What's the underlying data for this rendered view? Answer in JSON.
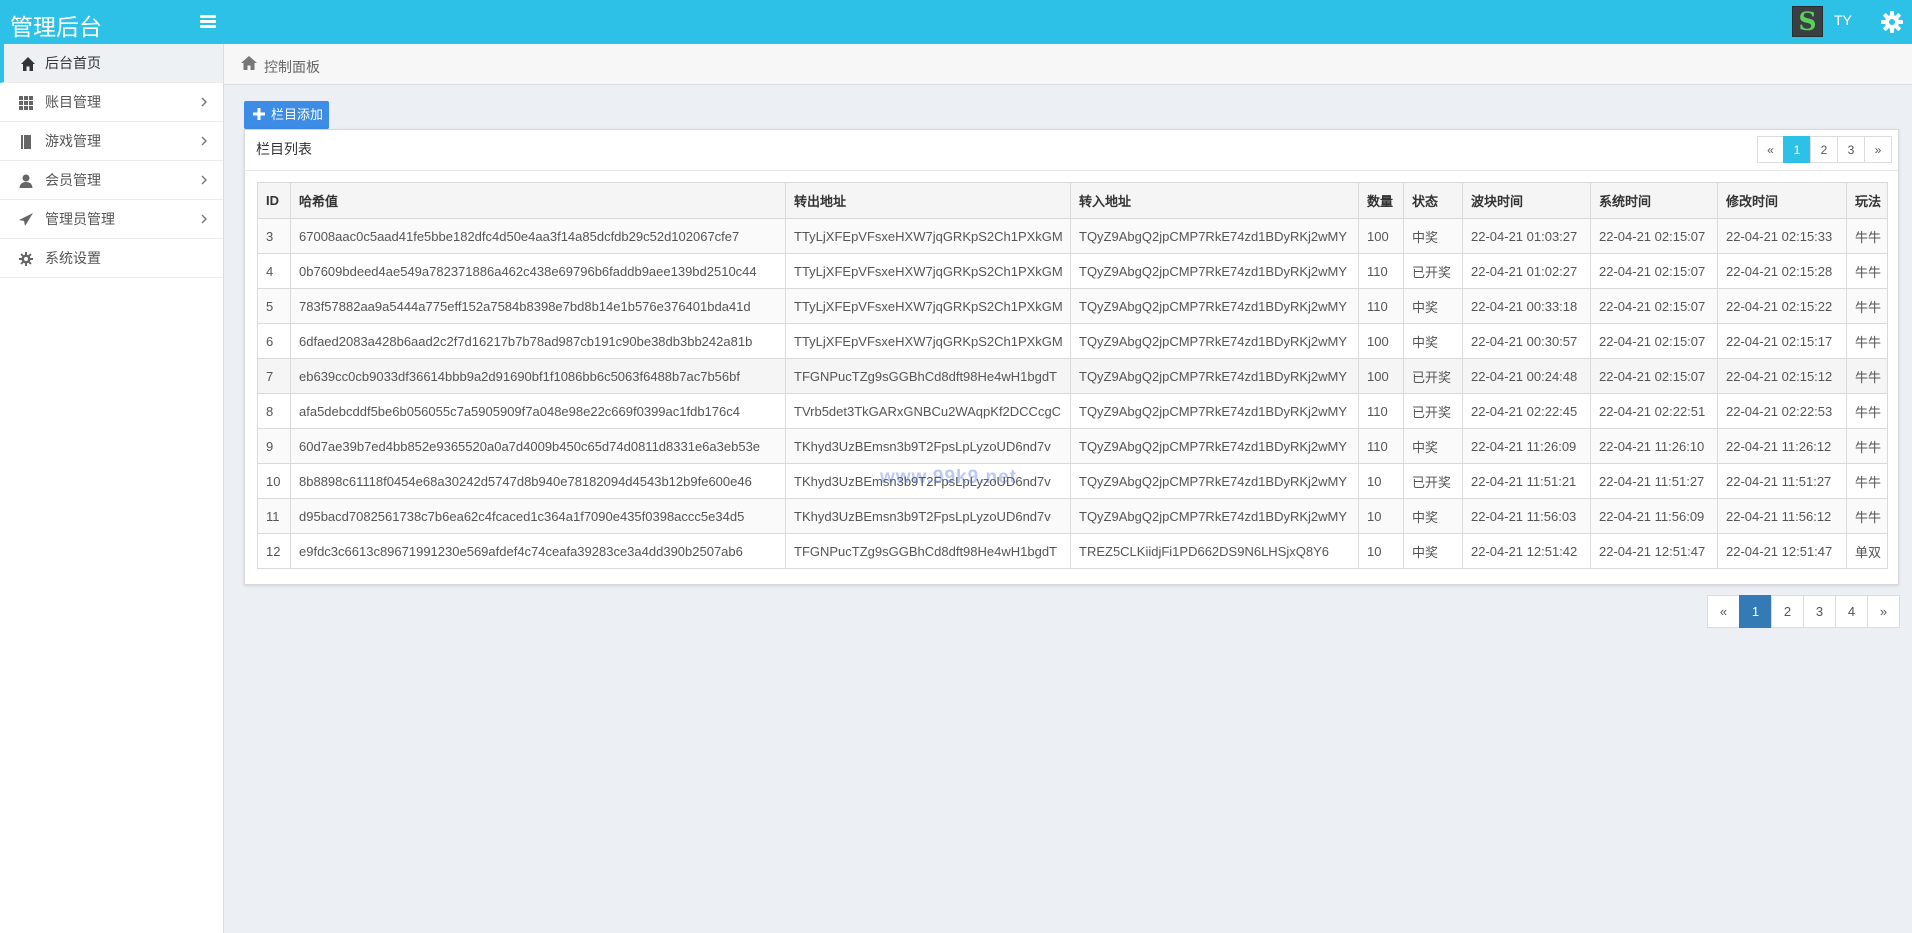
{
  "app": {
    "title": "管理后台"
  },
  "header": {
    "avatar_letter": "S",
    "username": "TY"
  },
  "sidebar": {
    "items": [
      {
        "label": "后台首页",
        "icon": "home-icon"
      },
      {
        "label": "账目管理",
        "icon": "grid-icon"
      },
      {
        "label": "游戏管理",
        "icon": "book-icon"
      },
      {
        "label": "会员管理",
        "icon": "user-icon"
      },
      {
        "label": "管理员管理",
        "icon": "send-icon"
      },
      {
        "label": "系统设置",
        "icon": "gear-icon"
      }
    ]
  },
  "breadcrumb": {
    "label": "控制面板"
  },
  "toolbar": {
    "add_label": "栏目添加"
  },
  "panel": {
    "title": "栏目列表"
  },
  "pagination_top": [
    "«",
    "1",
    "2",
    "3",
    "»"
  ],
  "pagination_bottom": [
    "«",
    "1",
    "2",
    "3",
    "4",
    "»"
  ],
  "table": {
    "headers": [
      "ID",
      "哈希值",
      "转出地址",
      "转入地址",
      "数量",
      "状态",
      "波块时间",
      "系统时间",
      "修改时间",
      "玩法"
    ],
    "rows": [
      [
        "3",
        "67008aac0c5aad41fe5bbe182dfc4d50e4aa3f14a85dcfdb29c52d102067cfe7",
        "TTyLjXFEpVFsxeHXW7jqGRKpS2Ch1PXkGM",
        "TQyZ9AbgQ2jpCMP7RkE74zd1BDyRKj2wMY",
        "100",
        "中奖",
        "22-04-21 01:03:27",
        "22-04-21 02:15:07",
        "22-04-21 02:15:33",
        "牛牛"
      ],
      [
        "4",
        "0b7609bdeed4ae549a782371886a462c438e69796b6faddb9aee139bd2510c44",
        "TTyLjXFEpVFsxeHXW7jqGRKpS2Ch1PXkGM",
        "TQyZ9AbgQ2jpCMP7RkE74zd1BDyRKj2wMY",
        "110",
        "已开奖",
        "22-04-21 01:02:27",
        "22-04-21 02:15:07",
        "22-04-21 02:15:28",
        "牛牛"
      ],
      [
        "5",
        "783f57882aa9a5444a775eff152a7584b8398e7bd8b14e1b576e376401bda41d",
        "TTyLjXFEpVFsxeHXW7jqGRKpS2Ch1PXkGM",
        "TQyZ9AbgQ2jpCMP7RkE74zd1BDyRKj2wMY",
        "110",
        "中奖",
        "22-04-21 00:33:18",
        "22-04-21 02:15:07",
        "22-04-21 02:15:22",
        "牛牛"
      ],
      [
        "6",
        "6dfaed2083a428b6aad2c2f7d16217b7b78ad987cb191c90be38db3bb242a81b",
        "TTyLjXFEpVFsxeHXW7jqGRKpS2Ch1PXkGM",
        "TQyZ9AbgQ2jpCMP7RkE74zd1BDyRKj2wMY",
        "100",
        "中奖",
        "22-04-21 00:30:57",
        "22-04-21 02:15:07",
        "22-04-21 02:15:17",
        "牛牛"
      ],
      [
        "7",
        "eb639cc0cb9033df36614bbb9a2d91690bf1f1086bb6c5063f6488b7ac7b56bf",
        "TFGNPucTZg9sGGBhCd8dft98He4wH1bgdT",
        "TQyZ9AbgQ2jpCMP7RkE74zd1BDyRKj2wMY",
        "100",
        "已开奖",
        "22-04-21 00:24:48",
        "22-04-21 02:15:07",
        "22-04-21 02:15:12",
        "牛牛"
      ],
      [
        "8",
        "afa5debcddf5be6b056055c7a5905909f7a048e98e22c669f0399ac1fdb176c4",
        "TVrb5det3TkGARxGNBCu2WAqpKf2DCCcgC",
        "TQyZ9AbgQ2jpCMP7RkE74zd1BDyRKj2wMY",
        "110",
        "已开奖",
        "22-04-21 02:22:45",
        "22-04-21 02:22:51",
        "22-04-21 02:22:53",
        "牛牛"
      ],
      [
        "9",
        "60d7ae39b7ed4bb852e9365520a0a7d4009b450c65d74d0811d8331e6a3eb53e",
        "TKhyd3UzBEmsn3b9T2FpsLpLyzoUD6nd7v",
        "TQyZ9AbgQ2jpCMP7RkE74zd1BDyRKj2wMY",
        "110",
        "中奖",
        "22-04-21 11:26:09",
        "22-04-21 11:26:10",
        "22-04-21 11:26:12",
        "牛牛"
      ],
      [
        "10",
        "8b8898c61118f0454e68a30242d5747d8b940e78182094d4543b12b9fe600e46",
        "TKhyd3UzBEmsn3b9T2FpsLpLyzoUD6nd7v",
        "TQyZ9AbgQ2jpCMP7RkE74zd1BDyRKj2wMY",
        "10",
        "已开奖",
        "22-04-21 11:51:21",
        "22-04-21 11:51:27",
        "22-04-21 11:51:27",
        "牛牛"
      ],
      [
        "11",
        "d95bacd7082561738c7b6ea62c4fcaced1c364a1f7090e435f0398accc5e34d5",
        "TKhyd3UzBEmsn3b9T2FpsLpLyzoUD6nd7v",
        "TQyZ9AbgQ2jpCMP7RkE74zd1BDyRKj2wMY",
        "10",
        "中奖",
        "22-04-21 11:56:03",
        "22-04-21 11:56:09",
        "22-04-21 11:56:12",
        "牛牛"
      ],
      [
        "12",
        "e9fdc3c6613c89671991230e569afdef4c74ceafa39283ce3a4dd390b2507ab6",
        "TFGNPucTZg9sGGBhCd8dft98He4wH1bgdT",
        "TREZ5CLKiidjFi1PD662DS9N6LHSjxQ8Y6",
        "10",
        "中奖",
        "22-04-21 12:51:42",
        "22-04-21 12:51:47",
        "22-04-21 12:51:47",
        "单双"
      ]
    ]
  },
  "watermark": "www.99k9.net",
  "colors": {
    "topbar": "#2ec1e8",
    "add_button": "#3d8ce6",
    "page_active_top": "#2ec1e8",
    "page_active_bottom": "#337ab7"
  }
}
